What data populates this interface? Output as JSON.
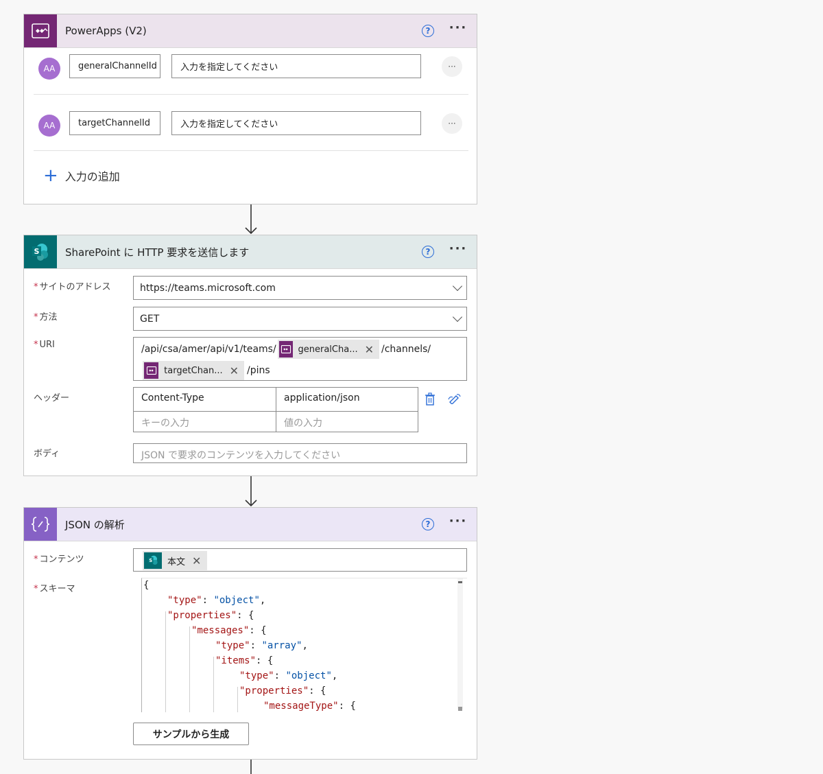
{
  "powerapps": {
    "title": "PowerApps (V2)",
    "inputs": [
      {
        "avatar": "AA",
        "name": "generalChannelId",
        "placeholder": "入力を指定してください"
      },
      {
        "avatar": "AA",
        "name": "targetChannelId",
        "placeholder": "入力を指定してください"
      }
    ],
    "add_input": "入力の追加"
  },
  "sharepoint": {
    "title": "SharePoint に HTTP 要求を送信します",
    "site_label": "サイトのアドレス",
    "site_value": "https://teams.microsoft.com",
    "method_label": "方法",
    "method_value": "GET",
    "uri_label": "URI",
    "uri_part1": "/api/csa/amer/api/v1/teams/",
    "uri_token1": "generalCha...",
    "uri_part2": "/channels/",
    "uri_token2": "targetChan...",
    "uri_part3": "/pins",
    "headers_label": "ヘッダー",
    "header_key": "Content-Type",
    "header_value": "application/json",
    "key_placeholder": "キーの入力",
    "value_placeholder": "値の入力",
    "body_label": "ボディ",
    "body_placeholder": "JSON で要求のコンテンツを入力してください"
  },
  "json_parse": {
    "title": "JSON の解析",
    "content_label": "コンテンツ",
    "content_token": "本文",
    "schema_label": "スキーマ",
    "schema_lines": [
      {
        "indent": 0,
        "key": "",
        "val": "",
        "tail": "{"
      },
      {
        "indent": 1,
        "key": "\"type\"",
        "val": "\"object\"",
        "tail": ","
      },
      {
        "indent": 1,
        "key": "\"properties\"",
        "val": "",
        "tail": "{"
      },
      {
        "indent": 2,
        "key": "\"messages\"",
        "val": "",
        "tail": "{"
      },
      {
        "indent": 3,
        "key": "\"type\"",
        "val": "\"array\"",
        "tail": ","
      },
      {
        "indent": 3,
        "key": "\"items\"",
        "val": "",
        "tail": "{"
      },
      {
        "indent": 4,
        "key": "\"type\"",
        "val": "\"object\"",
        "tail": ","
      },
      {
        "indent": 4,
        "key": "\"properties\"",
        "val": "",
        "tail": "{"
      },
      {
        "indent": 5,
        "key": "\"messageType\"",
        "val": "",
        "tail": "{"
      }
    ],
    "generate_button": "サンプルから生成"
  },
  "colors": {
    "powerapps_accent": "#742774",
    "sharepoint_accent": "#036c70",
    "json_accent": "#8661c5",
    "required": "#c4314b",
    "link_blue": "#2b6cd6"
  }
}
